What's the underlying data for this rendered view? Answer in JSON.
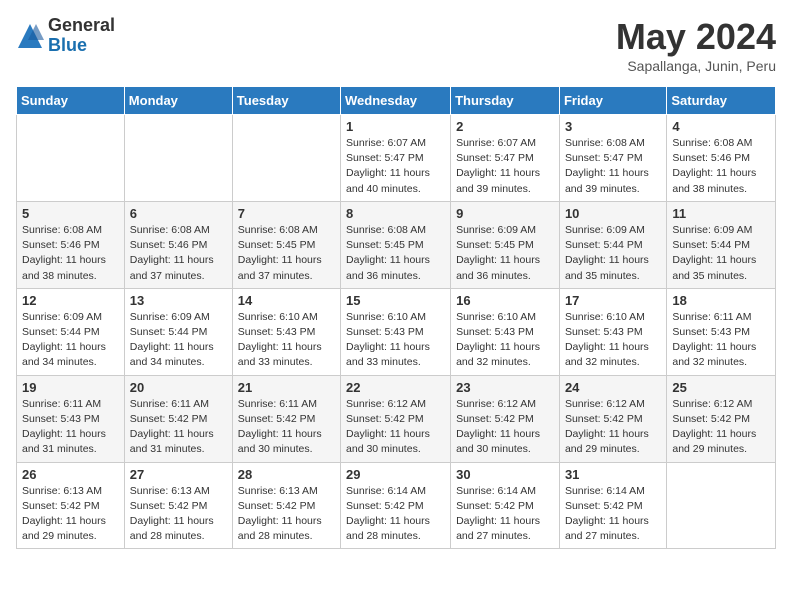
{
  "logo": {
    "general": "General",
    "blue": "Blue"
  },
  "title": {
    "month_year": "May 2024",
    "location": "Sapallanga, Junin, Peru"
  },
  "header_days": [
    "Sunday",
    "Monday",
    "Tuesday",
    "Wednesday",
    "Thursday",
    "Friday",
    "Saturday"
  ],
  "weeks": [
    [
      {
        "day": "",
        "info": ""
      },
      {
        "day": "",
        "info": ""
      },
      {
        "day": "",
        "info": ""
      },
      {
        "day": "1",
        "info": "Sunrise: 6:07 AM\nSunset: 5:47 PM\nDaylight: 11 hours\nand 40 minutes."
      },
      {
        "day": "2",
        "info": "Sunrise: 6:07 AM\nSunset: 5:47 PM\nDaylight: 11 hours\nand 39 minutes."
      },
      {
        "day": "3",
        "info": "Sunrise: 6:08 AM\nSunset: 5:47 PM\nDaylight: 11 hours\nand 39 minutes."
      },
      {
        "day": "4",
        "info": "Sunrise: 6:08 AM\nSunset: 5:46 PM\nDaylight: 11 hours\nand 38 minutes."
      }
    ],
    [
      {
        "day": "5",
        "info": "Sunrise: 6:08 AM\nSunset: 5:46 PM\nDaylight: 11 hours\nand 38 minutes."
      },
      {
        "day": "6",
        "info": "Sunrise: 6:08 AM\nSunset: 5:46 PM\nDaylight: 11 hours\nand 37 minutes."
      },
      {
        "day": "7",
        "info": "Sunrise: 6:08 AM\nSunset: 5:45 PM\nDaylight: 11 hours\nand 37 minutes."
      },
      {
        "day": "8",
        "info": "Sunrise: 6:08 AM\nSunset: 5:45 PM\nDaylight: 11 hours\nand 36 minutes."
      },
      {
        "day": "9",
        "info": "Sunrise: 6:09 AM\nSunset: 5:45 PM\nDaylight: 11 hours\nand 36 minutes."
      },
      {
        "day": "10",
        "info": "Sunrise: 6:09 AM\nSunset: 5:44 PM\nDaylight: 11 hours\nand 35 minutes."
      },
      {
        "day": "11",
        "info": "Sunrise: 6:09 AM\nSunset: 5:44 PM\nDaylight: 11 hours\nand 35 minutes."
      }
    ],
    [
      {
        "day": "12",
        "info": "Sunrise: 6:09 AM\nSunset: 5:44 PM\nDaylight: 11 hours\nand 34 minutes."
      },
      {
        "day": "13",
        "info": "Sunrise: 6:09 AM\nSunset: 5:44 PM\nDaylight: 11 hours\nand 34 minutes."
      },
      {
        "day": "14",
        "info": "Sunrise: 6:10 AM\nSunset: 5:43 PM\nDaylight: 11 hours\nand 33 minutes."
      },
      {
        "day": "15",
        "info": "Sunrise: 6:10 AM\nSunset: 5:43 PM\nDaylight: 11 hours\nand 33 minutes."
      },
      {
        "day": "16",
        "info": "Sunrise: 6:10 AM\nSunset: 5:43 PM\nDaylight: 11 hours\nand 32 minutes."
      },
      {
        "day": "17",
        "info": "Sunrise: 6:10 AM\nSunset: 5:43 PM\nDaylight: 11 hours\nand 32 minutes."
      },
      {
        "day": "18",
        "info": "Sunrise: 6:11 AM\nSunset: 5:43 PM\nDaylight: 11 hours\nand 32 minutes."
      }
    ],
    [
      {
        "day": "19",
        "info": "Sunrise: 6:11 AM\nSunset: 5:43 PM\nDaylight: 11 hours\nand 31 minutes."
      },
      {
        "day": "20",
        "info": "Sunrise: 6:11 AM\nSunset: 5:42 PM\nDaylight: 11 hours\nand 31 minutes."
      },
      {
        "day": "21",
        "info": "Sunrise: 6:11 AM\nSunset: 5:42 PM\nDaylight: 11 hours\nand 30 minutes."
      },
      {
        "day": "22",
        "info": "Sunrise: 6:12 AM\nSunset: 5:42 PM\nDaylight: 11 hours\nand 30 minutes."
      },
      {
        "day": "23",
        "info": "Sunrise: 6:12 AM\nSunset: 5:42 PM\nDaylight: 11 hours\nand 30 minutes."
      },
      {
        "day": "24",
        "info": "Sunrise: 6:12 AM\nSunset: 5:42 PM\nDaylight: 11 hours\nand 29 minutes."
      },
      {
        "day": "25",
        "info": "Sunrise: 6:12 AM\nSunset: 5:42 PM\nDaylight: 11 hours\nand 29 minutes."
      }
    ],
    [
      {
        "day": "26",
        "info": "Sunrise: 6:13 AM\nSunset: 5:42 PM\nDaylight: 11 hours\nand 29 minutes."
      },
      {
        "day": "27",
        "info": "Sunrise: 6:13 AM\nSunset: 5:42 PM\nDaylight: 11 hours\nand 28 minutes."
      },
      {
        "day": "28",
        "info": "Sunrise: 6:13 AM\nSunset: 5:42 PM\nDaylight: 11 hours\nand 28 minutes."
      },
      {
        "day": "29",
        "info": "Sunrise: 6:14 AM\nSunset: 5:42 PM\nDaylight: 11 hours\nand 28 minutes."
      },
      {
        "day": "30",
        "info": "Sunrise: 6:14 AM\nSunset: 5:42 PM\nDaylight: 11 hours\nand 27 minutes."
      },
      {
        "day": "31",
        "info": "Sunrise: 6:14 AM\nSunset: 5:42 PM\nDaylight: 11 hours\nand 27 minutes."
      },
      {
        "day": "",
        "info": ""
      }
    ]
  ]
}
